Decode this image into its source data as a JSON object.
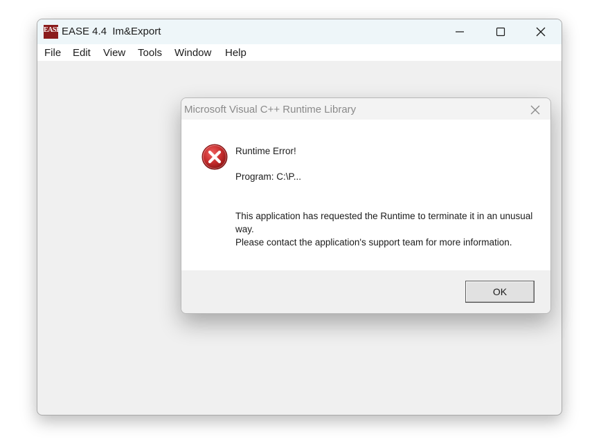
{
  "main_window": {
    "icon_text": "EASE",
    "title": "EASE 4.4  Im&Export",
    "controls": {
      "minimize": "minimize",
      "maximize": "maximize",
      "close": "close"
    },
    "menu": [
      "File",
      "Edit",
      "View",
      "Tools",
      "Window",
      "Help"
    ]
  },
  "dialog": {
    "title": "Microsoft Visual C++ Runtime Library",
    "icon": "error-icon",
    "message_title": "Runtime Error!",
    "program": "Program: C:\\P...",
    "message_line1": "This application has requested the Runtime to terminate it in an unusual way.",
    "message_line2": "Please contact the application's support team for more information.",
    "ok_label": "OK"
  },
  "colors": {
    "titlebar": "#eef6f9",
    "error_red": "#c42b2b",
    "window_bg": "#f0f0f0"
  }
}
